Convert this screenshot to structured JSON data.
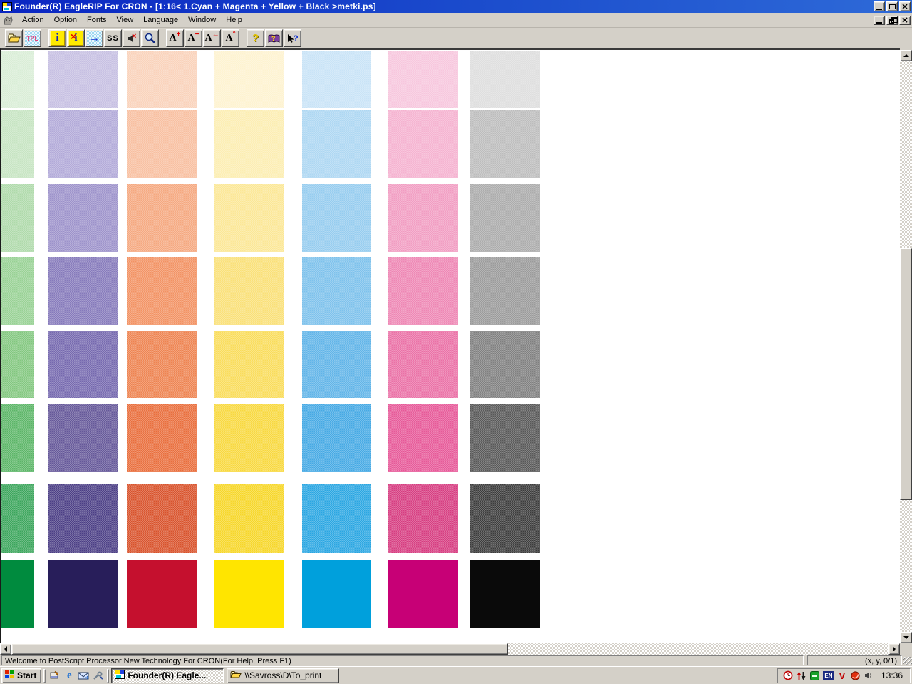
{
  "window": {
    "title": "Founder(R) EagleRIP For CRON - [1:16< 1.Cyan + Magenta + Yellow + Black >metki.ps]"
  },
  "menu": {
    "items": [
      "Action",
      "Option",
      "Fonts",
      "View",
      "Language",
      "Window",
      "Help"
    ]
  },
  "toolbar": {
    "buttons": [
      {
        "name": "open-file-button",
        "icon": "folder",
        "gap": false
      },
      {
        "name": "template-button",
        "icon": "tpl",
        "label": "TPL",
        "gap": false
      },
      {
        "name": "info-on-button",
        "icon": "info",
        "label": "i",
        "gap": true
      },
      {
        "name": "info-off-button",
        "icon": "info-x",
        "label": "i",
        "x": "×",
        "gap": false
      },
      {
        "name": "forward-button",
        "icon": "arrow",
        "label": "→",
        "gap": false
      },
      {
        "name": "ss-button",
        "icon": "ss",
        "label": "SS",
        "gap": false
      },
      {
        "name": "mute-button",
        "icon": "speaker",
        "x": "×",
        "gap": false
      },
      {
        "name": "zoom-button",
        "icon": "zoom",
        "gap": false
      },
      {
        "name": "font-increase-button",
        "icon": "a-mod",
        "label": "A",
        "sup": "+",
        "gap": true
      },
      {
        "name": "font-decrease-button",
        "icon": "a-mod",
        "label": "A",
        "sup": "−",
        "gap": false
      },
      {
        "name": "font-width-button",
        "icon": "a-mod",
        "label": "A",
        "sup": "↔",
        "gap": false
      },
      {
        "name": "font-rotate-button",
        "icon": "a-mod",
        "label": "A",
        "sup": "°",
        "gap": false
      },
      {
        "name": "help-button",
        "icon": "question",
        "label": "?",
        "gap": true
      },
      {
        "name": "help-topics-button",
        "icon": "book",
        "label": "?",
        "gap": false
      },
      {
        "name": "context-help-button",
        "icon": "context-help",
        "label": "?",
        "gap": false
      }
    ]
  },
  "color_chart": {
    "description": "CMYK tint swatch grid, 7 ink columns x 8 tint rows (light to 100%)",
    "columns": [
      {
        "name": "green",
        "tints": [
          "#d9edd6",
          "#c6e4c2",
          "#aedaaa",
          "#98d194",
          "#82c77f",
          "#5bb567",
          "#3ba55c",
          "#008b3e"
        ]
      },
      {
        "name": "violet",
        "tints": [
          "#c6bfe2",
          "#b2a9d8",
          "#9c92ca",
          "#8579bb",
          "#7568ae",
          "#645799",
          "#4b3e85",
          "#281e5a"
        ]
      },
      {
        "name": "orange",
        "tints": [
          "#fad2ba",
          "#f8bfa0",
          "#f5a87f",
          "#f29263",
          "#ee8350",
          "#e96e3c",
          "#d8522b",
          "#c5102e"
        ]
      },
      {
        "name": "yellow",
        "tints": [
          "#fdf3d0",
          "#fcedb2",
          "#fbe795",
          "#fae077",
          "#f9dc5a",
          "#f8d83e",
          "#f6d728",
          "#ffe500"
        ]
      },
      {
        "name": "cyan",
        "tints": [
          "#c8e3f6",
          "#add7f2",
          "#95ccef",
          "#7dc1ec",
          "#60b4e8",
          "#45a9e4",
          "#29a6e2",
          "#00a0dc"
        ]
      },
      {
        "name": "magenta",
        "tints": [
          "#f7c6dd",
          "#f5b2d0",
          "#f19cc2",
          "#ee86b4",
          "#ea70a6",
          "#e65898",
          "#d63c80",
          "#c70076"
        ]
      },
      {
        "name": "black",
        "tints": [
          "#dedede",
          "#bcbcbc",
          "#ababab",
          "#9a9a9a",
          "#7f7f7f",
          "#575757",
          "#3b3b3b",
          "#0a0a0a"
        ]
      }
    ]
  },
  "statusbar": {
    "message": "Welcome to PostScript Processor New Technology For CRON(For Help, Press F1)",
    "coords": "(x, y, 0/1)"
  },
  "taskbar": {
    "start_label": "Start",
    "quick_launch": [
      {
        "name": "quicklaunch-show-desktop-icon"
      },
      {
        "name": "quicklaunch-internet-explorer-icon",
        "label": "e"
      },
      {
        "name": "quicklaunch-outlook-icon"
      },
      {
        "name": "quicklaunch-tools-icon"
      }
    ],
    "tasks": [
      {
        "label": "Founder(R) Eagle...",
        "active": true,
        "icon": "app"
      },
      {
        "label": "\\\\Savross\\D\\To_print",
        "active": false,
        "icon": "folder"
      }
    ],
    "tray_icons": [
      {
        "name": "tray-scheduler-icon",
        "kind": "clock"
      },
      {
        "name": "tray-updown-arrows-icon",
        "kind": "updown"
      },
      {
        "name": "tray-green-app-icon",
        "kind": "green"
      },
      {
        "name": "tray-language-indicator",
        "kind": "en",
        "label": "EN"
      },
      {
        "name": "tray-antivirus-icon",
        "kind": "v",
        "label": "V"
      },
      {
        "name": "tray-red-ball-icon",
        "kind": "ball"
      },
      {
        "name": "tray-volume-icon",
        "kind": "volume"
      }
    ],
    "clock": "13:36"
  }
}
